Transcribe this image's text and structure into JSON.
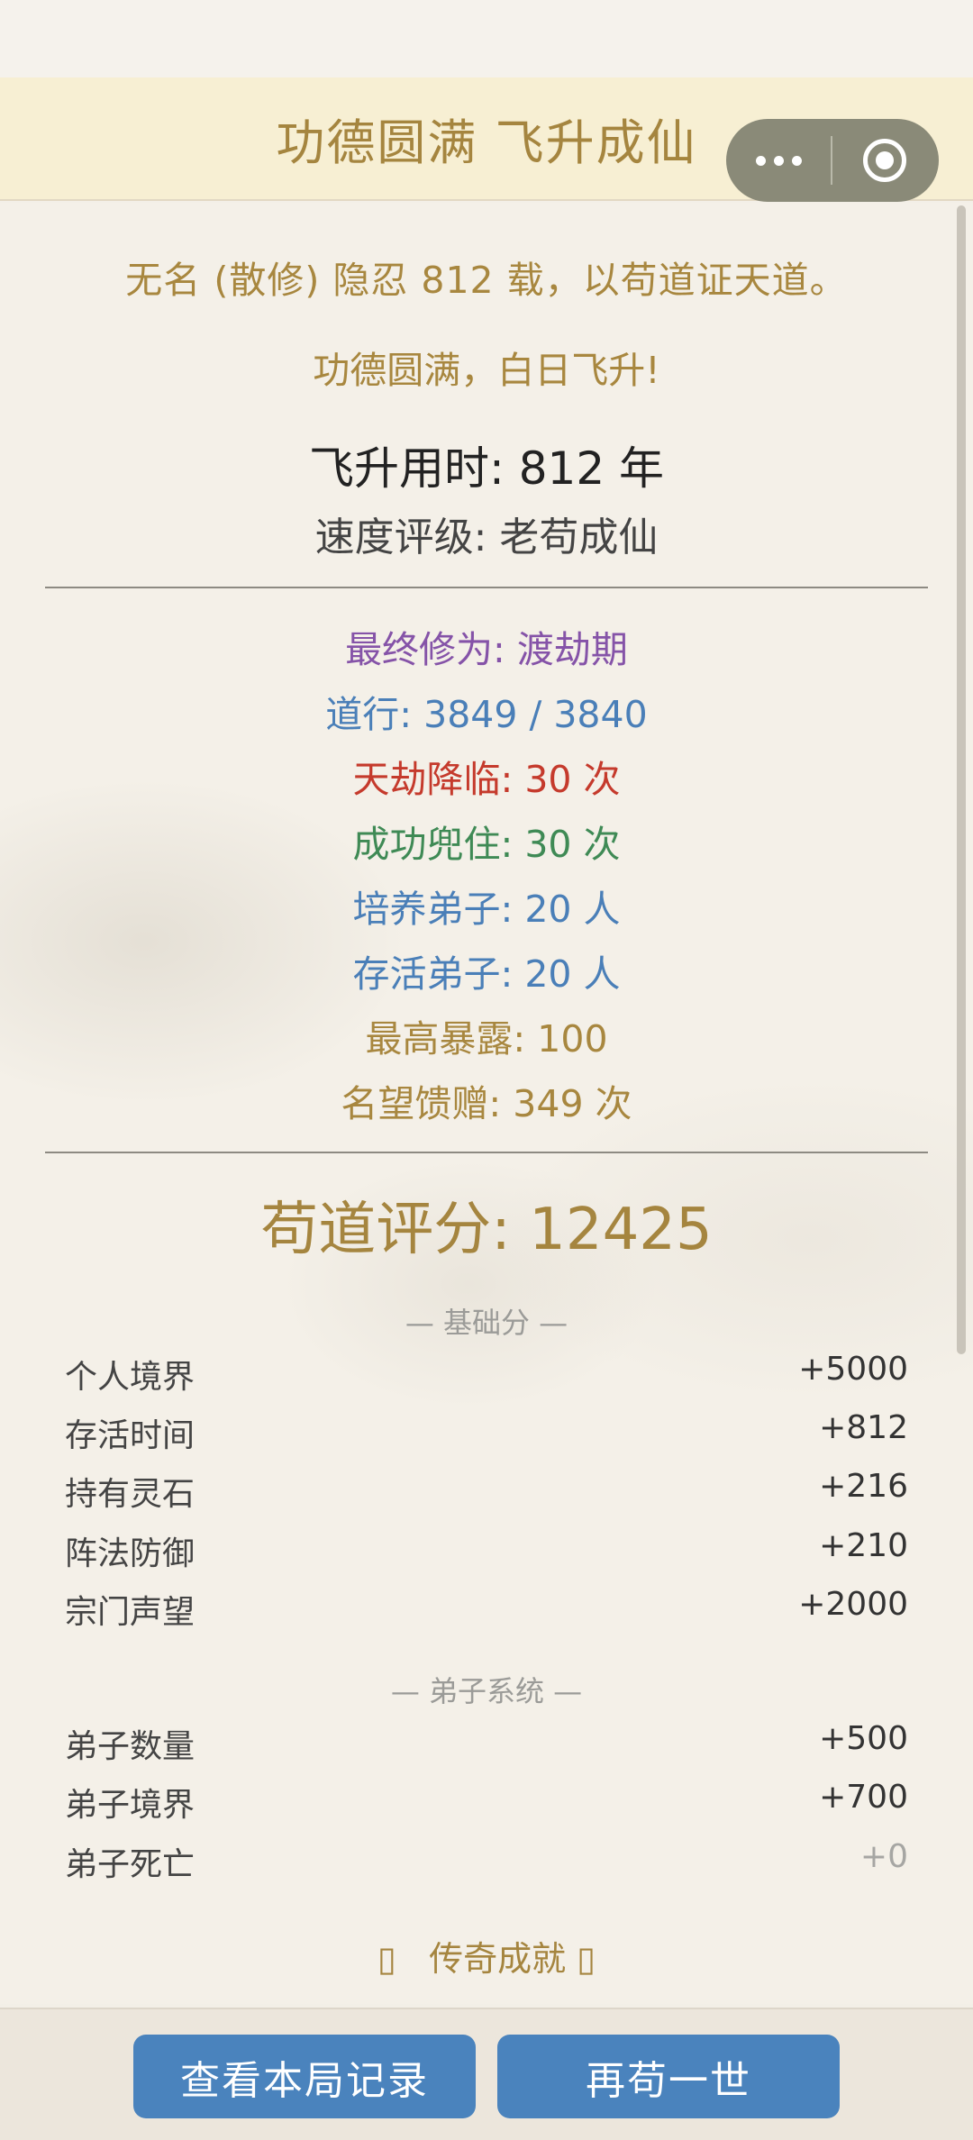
{
  "nav": {
    "title": "功德圆满 飞升成仙"
  },
  "summary": {
    "intro": "无名 (散修) 隐忍 812 载，以苟道证天道。",
    "subtitle": "功德圆满，白日飞升!",
    "time": "飞升用时: 812 年",
    "rating": "速度评级: 老苟成仙"
  },
  "stats": [
    {
      "text": "最终修为: 渡劫期",
      "color": "#8553a8"
    },
    {
      "text": "道行: 3849 / 3840",
      "color": "#4a7fb8"
    },
    {
      "text": "天劫降临: 30 次",
      "color": "#c53a2c"
    },
    {
      "text": "成功兜住: 30 次",
      "color": "#3f8a55"
    },
    {
      "text": "培养弟子: 20 人",
      "color": "#4a7fb8"
    },
    {
      "text": "存活弟子: 20 人",
      "color": "#4a7fb8"
    },
    {
      "text": "最高暴露: 100",
      "color": "#a8873f"
    },
    {
      "text": "名望馈赠: 349 次",
      "color": "#a8873f"
    }
  ],
  "score": {
    "label": "苟道评分: 12425"
  },
  "base_section": {
    "title": "— 基础分 —",
    "rows": [
      {
        "label": "个人境界",
        "value": "+5000"
      },
      {
        "label": "存活时间",
        "value": "+812"
      },
      {
        "label": "持有灵石",
        "value": "+216"
      },
      {
        "label": "阵法防御",
        "value": "+210"
      },
      {
        "label": "宗门声望",
        "value": "+2000"
      }
    ]
  },
  "disciple_section": {
    "title": "— 弟子系统 —",
    "rows": [
      {
        "label": "弟子数量",
        "value": "+500"
      },
      {
        "label": "弟子境界",
        "value": "+700"
      },
      {
        "label": "弟子死亡",
        "value": "+0"
      }
    ]
  },
  "legend": {
    "label": "传奇成就"
  },
  "footer": {
    "record_button": "查看本局记录",
    "retry_button": "再苟一世"
  }
}
